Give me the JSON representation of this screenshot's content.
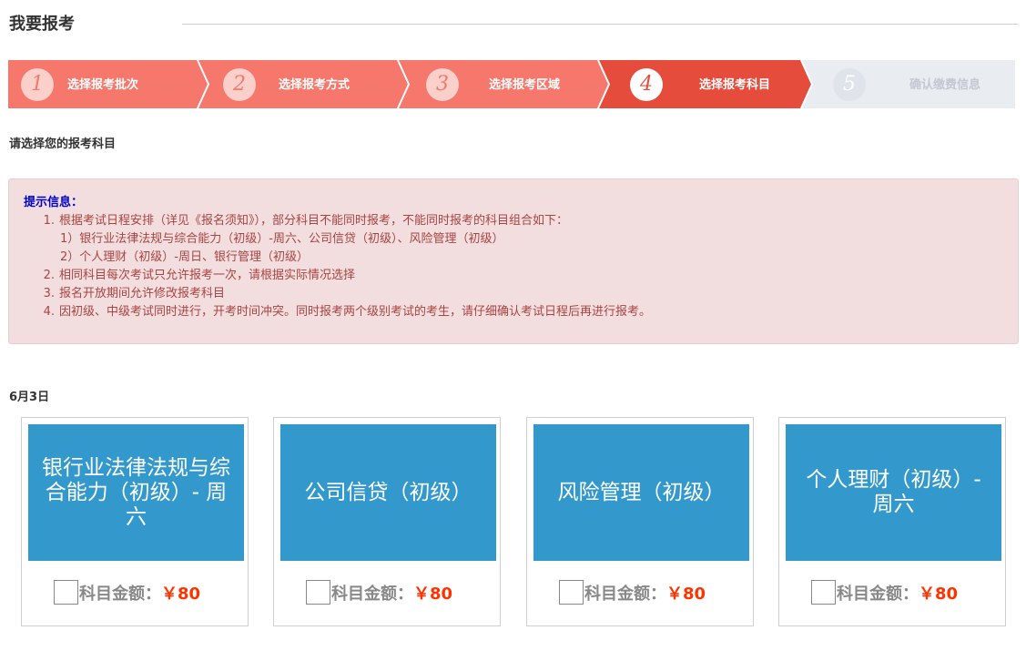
{
  "page": {
    "title": "我要报考"
  },
  "steps": [
    {
      "num": "1",
      "label": "选择报考批次",
      "state": "done"
    },
    {
      "num": "2",
      "label": "选择报考方式",
      "state": "done"
    },
    {
      "num": "3",
      "label": "选择报考区域",
      "state": "done"
    },
    {
      "num": "4",
      "label": "选择报考科目",
      "state": "active"
    },
    {
      "num": "5",
      "label": "确认缴费信息",
      "state": "todo"
    }
  ],
  "subtitle": "请选择您的报考科目",
  "notice": {
    "title": "提示信息：",
    "items": [
      {
        "num": "1.",
        "text": "根据考试日程安排（详见《报名须知》），部分科目不能同时报考，不能同时报考的科目组合如下："
      },
      {
        "num": "",
        "text": "1）银行业法律法规与综合能力（初级）-周六、公司信贷（初级）、风险管理（初级）"
      },
      {
        "num": "",
        "text": "2）个人理财（初级）-周日、银行管理（初级）"
      },
      {
        "num": "2.",
        "text": "相同科目每次考试只允许报考一次，请根据实际情况选择"
      },
      {
        "num": "3.",
        "text": "报名开放期间允许修改报考科目"
      },
      {
        "num": "4.",
        "text": "因初级、中级考试同时进行，开考时间冲突。同时报考两个级别考试的考生，请仔细确认考试日程后再进行报考。"
      }
    ]
  },
  "date_label": "6月3日",
  "subjects": [
    {
      "name": "银行业法律法规与综合能力（初级）- 周六",
      "fee_label": "科目金额：",
      "fee_amount": "￥80"
    },
    {
      "name": "公司信贷（初级）",
      "fee_label": "科目金额：",
      "fee_amount": "￥80"
    },
    {
      "name": "风险管理（初级）",
      "fee_label": "科目金额：",
      "fee_amount": "￥80"
    },
    {
      "name": "个人理财（初级）- 周六",
      "fee_label": "科目金额：",
      "fee_amount": "￥80"
    }
  ],
  "colors": {
    "step_done": "#f6776b",
    "step_active": "#e64c3c",
    "step_todo": "#e9ecf1",
    "step_todo_text": "#c3c8d1",
    "tile": "#3399cc",
    "fee_amount": "#ff3300"
  }
}
